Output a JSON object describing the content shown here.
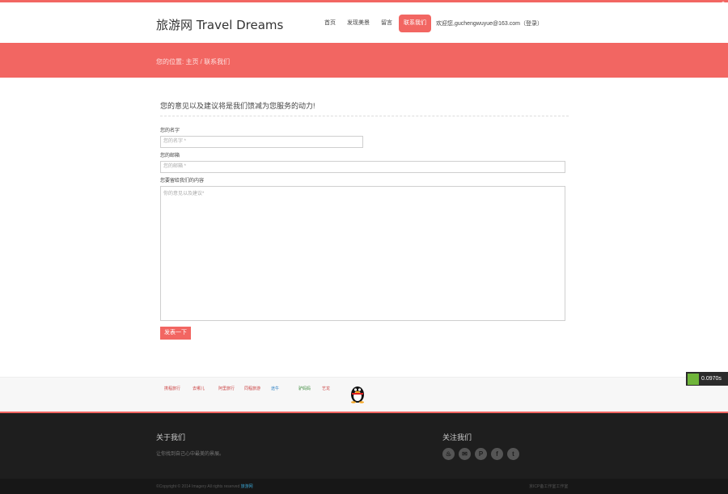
{
  "header": {
    "logo": "旅游网 Travel Dreams",
    "nav": [
      "首页",
      "发现美景",
      "留言",
      "联系我们"
    ],
    "active_index": 3,
    "welcome": "欢迎您,guchengwuyue@163.com（登录）"
  },
  "banner": {
    "breadcrumb": "您的位置: 主页 / 联系我们"
  },
  "form": {
    "title": "您的意见以及建议将是我们馈减为您服务的动力!",
    "name_label": "您的名字",
    "name_placeholder": "您的名字 *",
    "email_label": "您的邮箱",
    "email_placeholder": "您的邮箱 *",
    "content_label": "您要留给我们的内容",
    "content_placeholder": "你的意见以及建议*",
    "submit_label": "发表一下"
  },
  "partners": [
    "携程旅行",
    "去哪儿",
    "阿里旅行",
    "同程旅游",
    "途牛",
    "驴妈妈",
    "艺龙",
    "QQ"
  ],
  "footer": {
    "about_title": "关于我们",
    "about_text": "让你找到自己心中最美的景展。",
    "follow_title": "关注我们",
    "social": [
      "renren",
      "wechat",
      "pinterest",
      "facebook",
      "twitter"
    ],
    "copyright_prefix": "©Copyright © 2014 Imagery All rights reserved ",
    "copyright_brand": "旅游网",
    "copyright_right": "京ICP备工作室工作室"
  },
  "speed_badge": "0.0970s",
  "colors": {
    "accent": "#f26662",
    "footer_bg": "#1e1e1e"
  }
}
